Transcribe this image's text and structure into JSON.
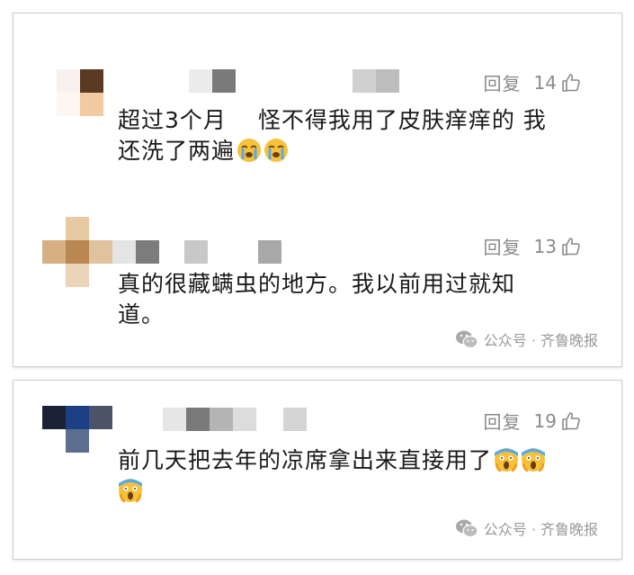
{
  "comments": [
    {
      "reply_label": "回复",
      "likes": "14",
      "text_lines": [
        "超过3个月　 怪不得我用了皮肤痒痒的 我",
        "还洗了两遍"
      ],
      "emojis": [
        "crying-face",
        "crying-face"
      ]
    },
    {
      "reply_label": "回复",
      "likes": "13",
      "text_lines": [
        "真的很藏螨虫的地方。我以前用过就知",
        "道。"
      ]
    },
    {
      "reply_label": "回复",
      "likes": "19",
      "text_lines": [
        "前几天把去年的凉席拿出来直接用了",
        ""
      ],
      "emojis": [
        "screaming-face",
        "screaming-face",
        "screaming-face"
      ]
    }
  ],
  "watermark": {
    "text": "公众号 · 齐鲁晚报",
    "icon": "wechat-icon"
  },
  "colors": {
    "meta_text": "#8a8a8a",
    "body_text": "#1a1a1a",
    "card_border": "#cfcfcf"
  }
}
